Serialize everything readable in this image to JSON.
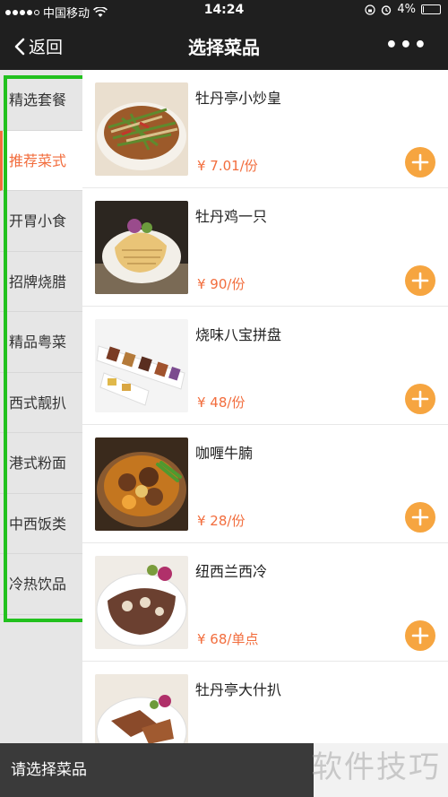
{
  "status_bar": {
    "carrier": "中国移动",
    "time": "14:24",
    "battery": "4%",
    "battery_level": 0.04
  },
  "nav": {
    "back_label": "返回",
    "title": "选择菜品"
  },
  "categories": [
    {
      "label": "精选套餐",
      "active": false
    },
    {
      "label": "推荐菜式",
      "active": true
    },
    {
      "label": "开胃小食",
      "active": false
    },
    {
      "label": "招牌烧腊",
      "active": false
    },
    {
      "label": "精品粤菜",
      "active": false
    },
    {
      "label": "西式靓扒",
      "active": false
    },
    {
      "label": "港式粉面",
      "active": false
    },
    {
      "label": "中西饭类",
      "active": false
    },
    {
      "label": "冷热饮品",
      "active": false
    }
  ],
  "dishes": [
    {
      "name": "牡丹亭小炒皇",
      "price": "¥ 7.01/份"
    },
    {
      "name": "牡丹鸡一只",
      "price": "¥ 90/份"
    },
    {
      "name": "烧味八宝拼盘",
      "price": "¥ 48/份"
    },
    {
      "name": "咖喱牛腩",
      "price": "¥ 28/份"
    },
    {
      "name": "纽西兰西冷",
      "price": "¥ 68/单点"
    },
    {
      "name": "牡丹亭大什扒",
      "price": ""
    }
  ],
  "bottom_bar": {
    "prompt": "请选择菜品"
  },
  "watermark": "软件技巧",
  "colors": {
    "accent": "#f26d3d",
    "add_button": "#f6a540",
    "highlight_box": "#22c11e",
    "header": "#1f1f1f"
  }
}
